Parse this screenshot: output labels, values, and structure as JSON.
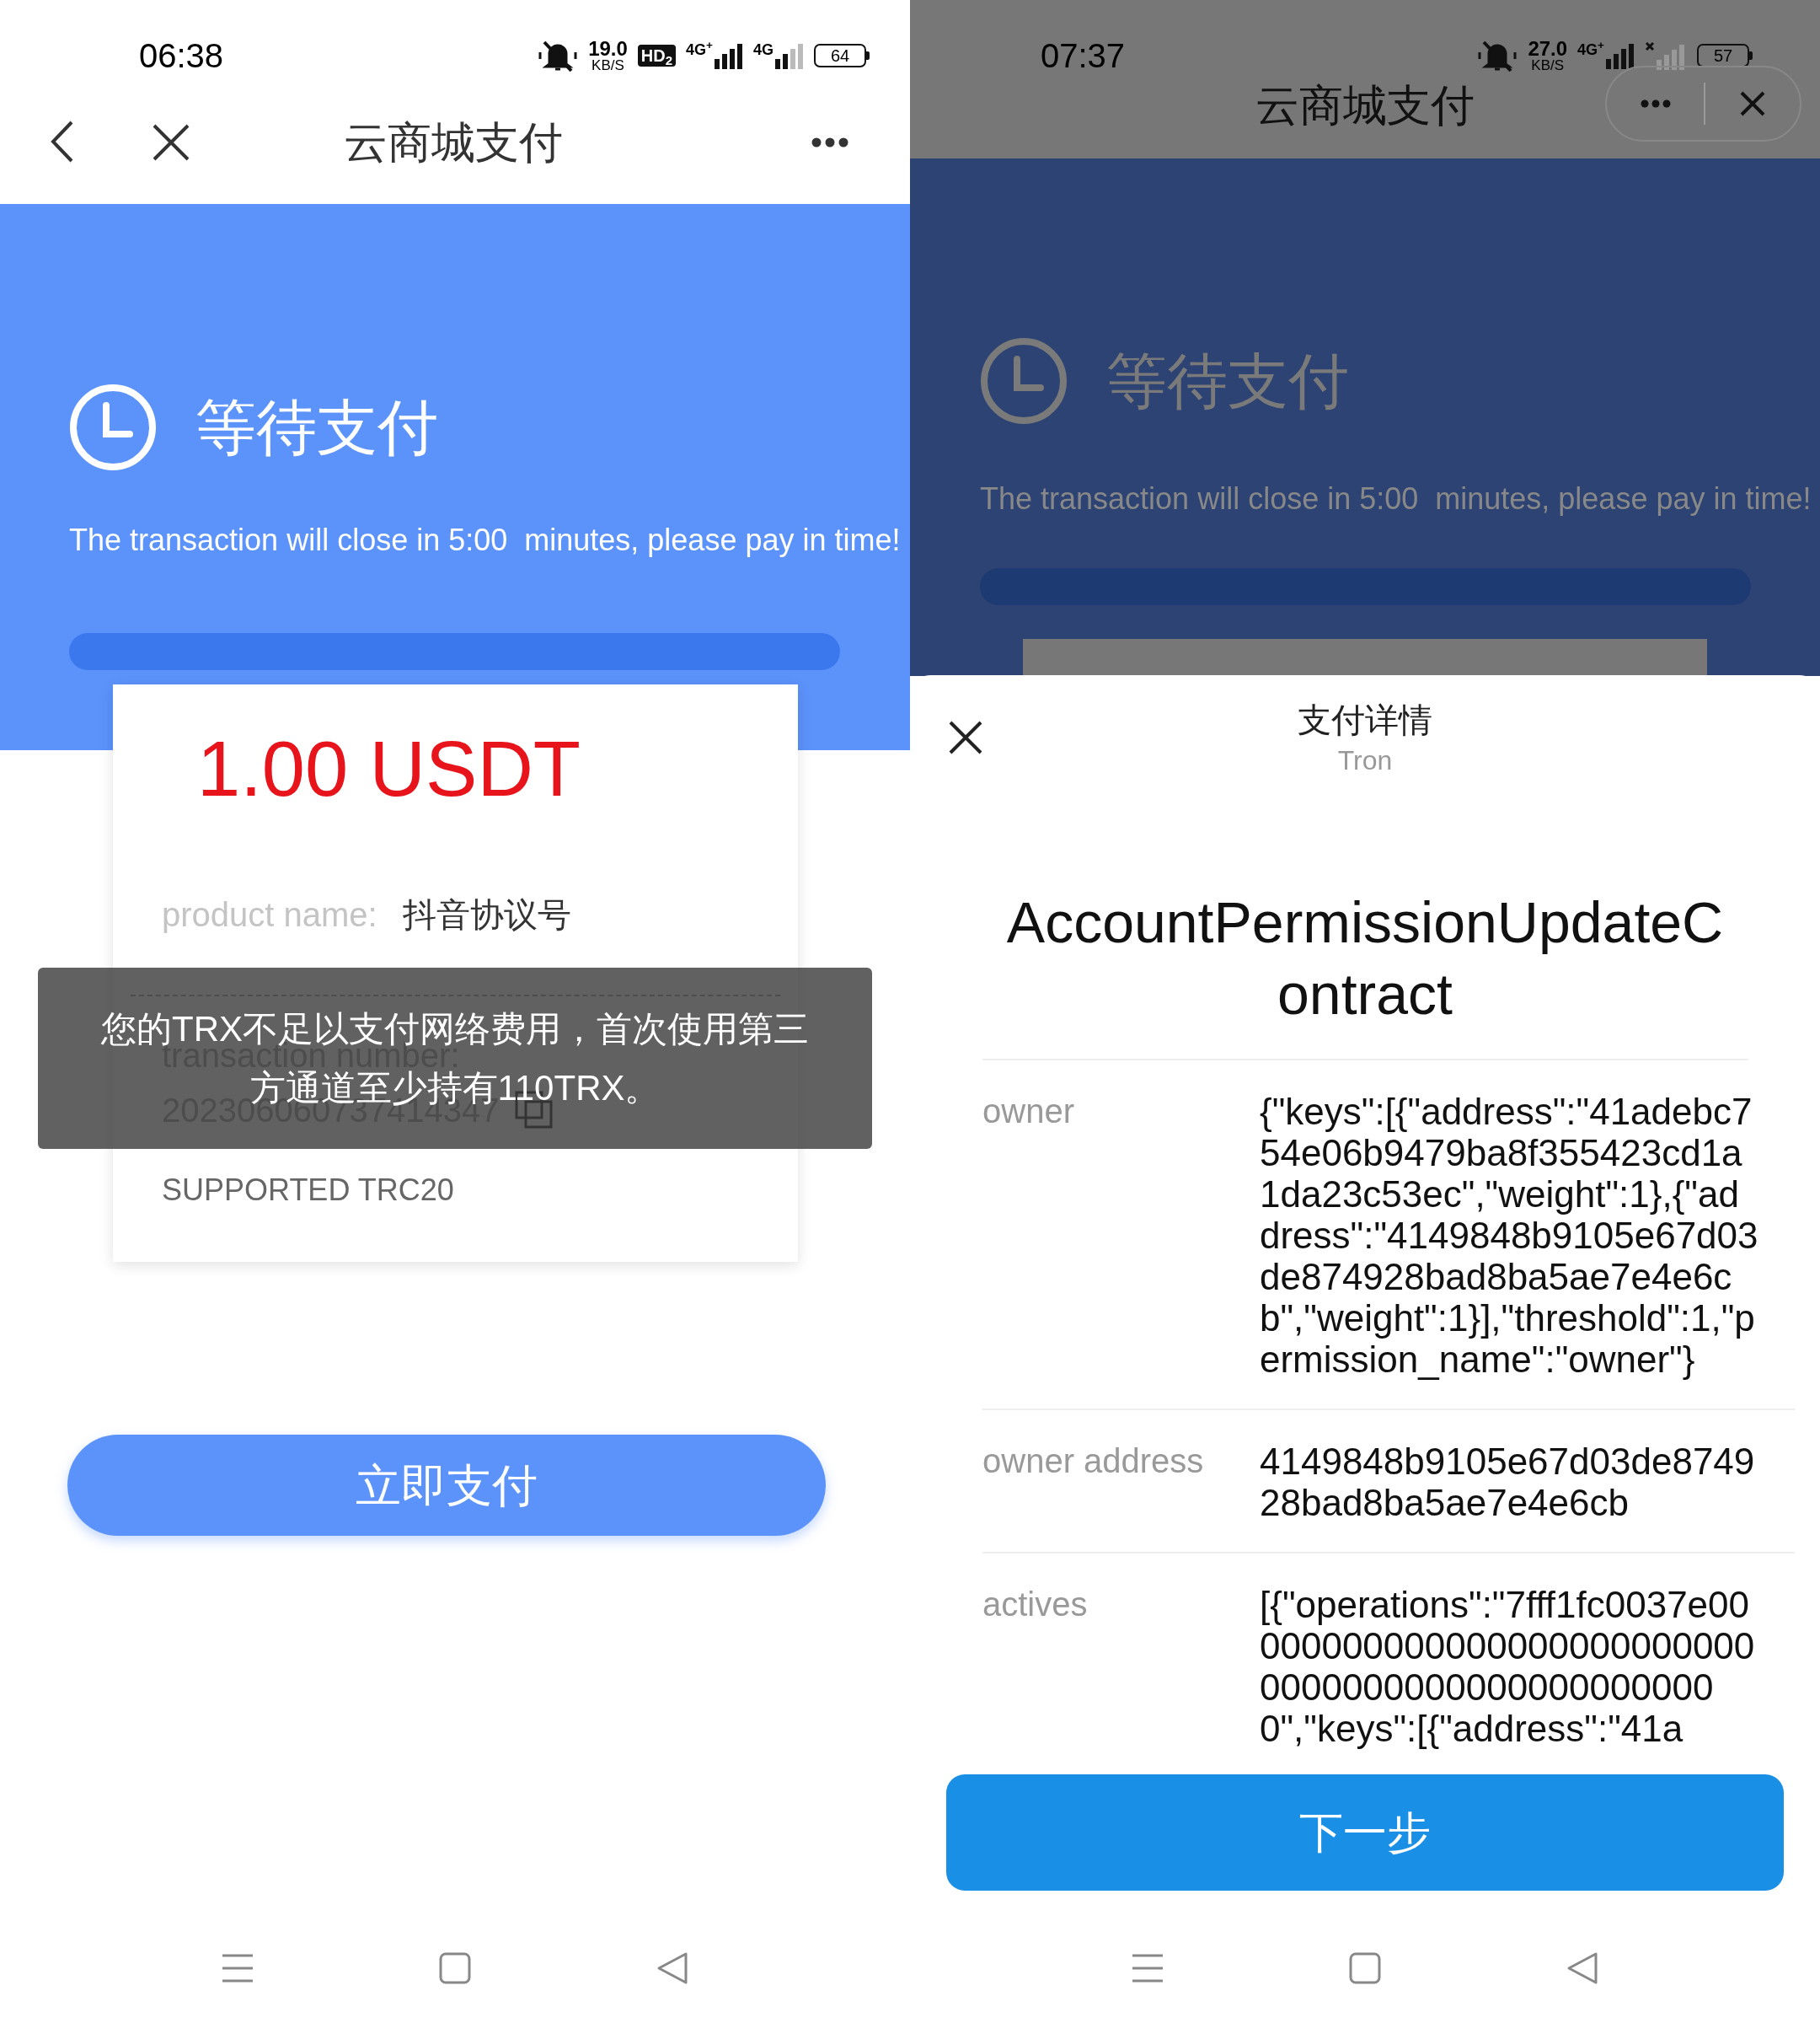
{
  "left_screen": {
    "status_bar": {
      "time": "06:38",
      "speed": "19.0",
      "speed_unit": "KB/S",
      "hd_badge": "HD$_{2}$",
      "sim1_label": "4G$^{+}$",
      "sim2_label": "4G",
      "battery": "64"
    },
    "nav": {
      "title": "云商城支付"
    },
    "status": {
      "title": "等待支付",
      "message": "The transaction will close in 5:00  minutes, please pay in time!"
    },
    "order": {
      "amount": "1.00 USDT",
      "product_label": "product name:",
      "product_value": "抖音协议号",
      "transaction_label": "transaction number:",
      "transaction_number": "202306060737414347",
      "network_note": "SUPPORTED TRC20"
    },
    "toast": {
      "message": "您的TRX不足以支付网络费用，首次使用第三方通道至少持有110TRX。"
    },
    "pay_button": "立即支付"
  },
  "right_screen": {
    "status_bar": {
      "time": "07:37",
      "speed": "27.0",
      "speed_unit": "KB/S",
      "sim1_label": "4G$^{+}$",
      "battery": "57"
    },
    "nav": {
      "title": "云商城支付"
    },
    "status": {
      "title": "等待支付",
      "message": "The transaction will close in 5:00  minutes, please pay in time!"
    },
    "sheet": {
      "title": "支付详情",
      "subtitle": "Tron",
      "contract_type": "AccountPermissionUpdateContract",
      "fields": [
        {
          "label": "owner",
          "value": "{\"keys\":[{\"address\":\"41adebc754e06b9479ba8f355423cd1a1da23c53ec\",\"weight\":1},{\"address\":\"4149848b9105e67d03de874928bad8ba5ae7e4e6cb\",\"weight\":1}],\"threshold\":1,\"permission_name\":\"owner\"}"
        },
        {
          "label": "owner address",
          "value": "4149848b9105e67d03de874928bad8ba5ae7e4e6cb"
        },
        {
          "label": "actives",
          "value": "[{\"operations\":\"7fff1fc0037e0000000000000000000000000000000000000000000000000\",\"keys\":[{\"address\":\"41a"
        }
      ]
    },
    "next_button": "下一步"
  }
}
